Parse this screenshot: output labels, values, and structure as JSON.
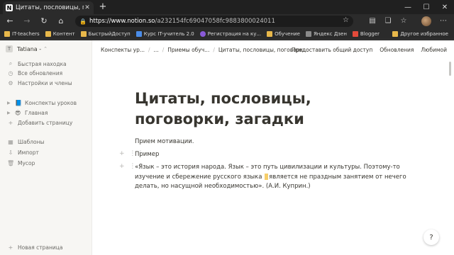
{
  "browser": {
    "tab_title": "Цитаты, пословицы, поговорк",
    "tab_favicon": "N",
    "new_tab": "+",
    "url_host": "https://www.notion.so",
    "url_path": "/a232154fc69047058fc9883800024011",
    "bookmarks": [
      {
        "label": "IT-teachers",
        "icon": "folder"
      },
      {
        "label": "Контент",
        "icon": "folder"
      },
      {
        "label": "БыстрыйДоступ",
        "icon": "folder"
      },
      {
        "label": "Курс IT-учитель 2.0",
        "icon": "blue"
      },
      {
        "label": "Регистрация на ку...",
        "icon": "purple"
      },
      {
        "label": "Обучение",
        "icon": "folder"
      },
      {
        "label": "Яндекс Дзен",
        "icon": "grey"
      },
      {
        "label": "Blogger",
        "icon": "red"
      }
    ],
    "other_bookmarks": "Другое избранное"
  },
  "sidebar": {
    "workspace": "Tatiana -",
    "workspace_badge": "T",
    "top_items": [
      {
        "label": "Быстрая находка",
        "icon": "search-icon"
      },
      {
        "label": "Все обновления",
        "icon": "clock-icon"
      },
      {
        "label": "Настройки и члены",
        "icon": "gear-icon"
      }
    ],
    "pages": [
      {
        "label": "Конспекты уроков",
        "emoji": "📘"
      },
      {
        "label": "Главная",
        "emoji": "😎"
      }
    ],
    "add_page": "Добавить страницу",
    "bottom_items": [
      {
        "label": "Шаблоны",
        "icon": "template-icon"
      },
      {
        "label": "Импорт",
        "icon": "import-icon"
      },
      {
        "label": "Мусор",
        "icon": "trash-icon"
      }
    ],
    "new_page": "Новая страница"
  },
  "topbar": {
    "crumbs": [
      "Конспекты ур...",
      "...",
      "Приемы обуч...",
      "Цитаты, пословицы, поговорк..."
    ],
    "share": "Предоставить общий доступ",
    "updates": "Обновления",
    "favorite": "Любимой"
  },
  "page": {
    "title": "Цитаты, пословицы, поговорки, загадки",
    "line1": "Прием мотивации.",
    "line2": "Пример",
    "quote_a": "«Язык – это история народа. Язык – это путь цивилизации и культуры. Поэтому-то изучение и сбережение русского языка ",
    "quote_b": "является не праздным занятием от нечего делать, но насущной необходимостью». (А.И. Куприн.)"
  },
  "help": "?"
}
